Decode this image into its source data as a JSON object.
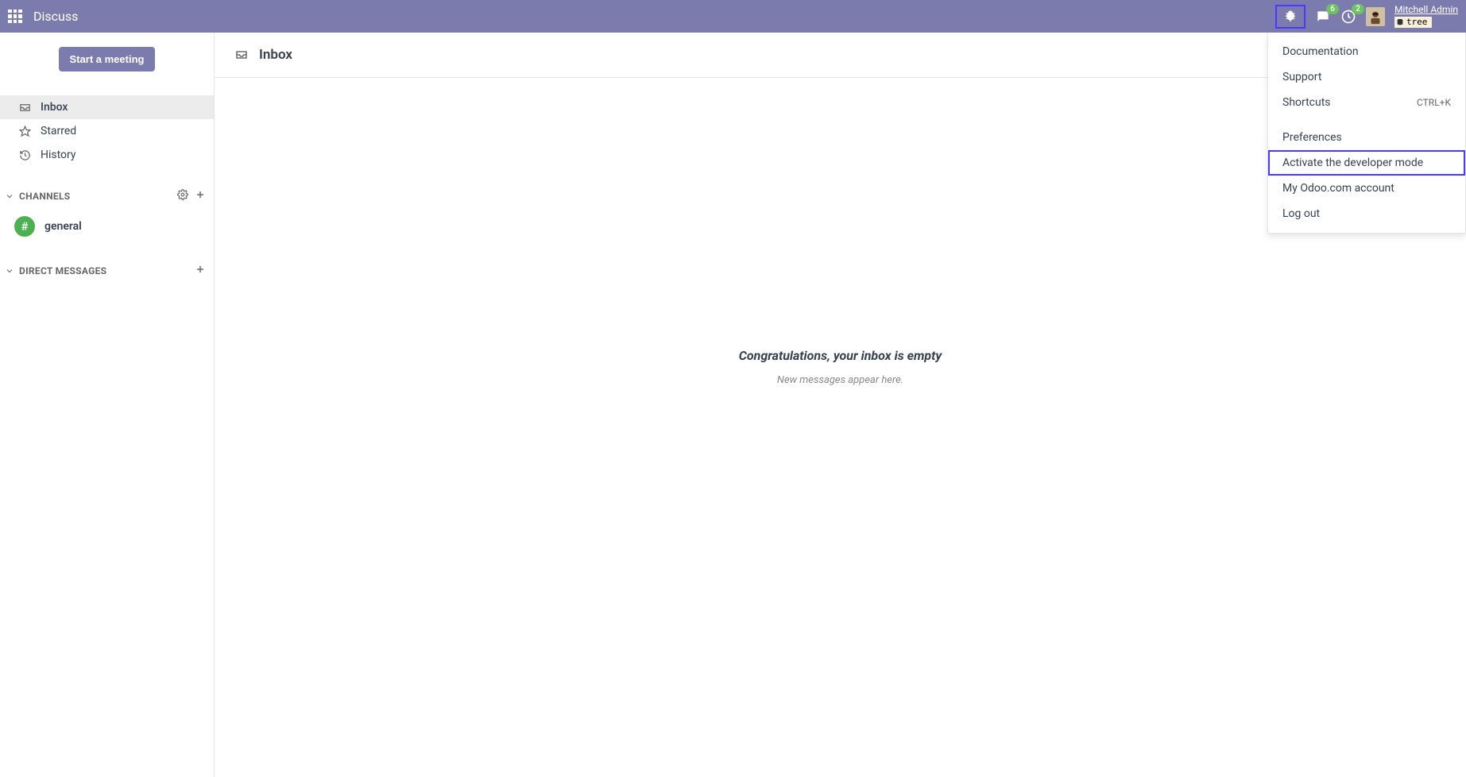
{
  "topbar": {
    "title": "Discuss",
    "chat_badge": "6",
    "activity_badge": "2",
    "user_name": "Mitchell Admin",
    "db_name": "tree"
  },
  "dropdown": {
    "documentation": "Documentation",
    "support": "Support",
    "shortcuts_label": "Shortcuts",
    "shortcuts_key": "CTRL+K",
    "preferences": "Preferences",
    "developer_mode": "Activate the developer mode",
    "odoo_account": "My Odoo.com account",
    "logout": "Log out"
  },
  "sidebar": {
    "start_meeting": "Start a meeting",
    "nav": {
      "inbox": "Inbox",
      "starred": "Starred",
      "history": "History"
    },
    "channels_header": "CHANNELS",
    "channels": [
      {
        "icon": "#",
        "name": "general"
      }
    ],
    "direct_messages_header": "DIRECT MESSAGES"
  },
  "content": {
    "title": "Inbox",
    "empty_title": "Congratulations, your inbox is empty",
    "empty_sub": "New messages appear here."
  }
}
